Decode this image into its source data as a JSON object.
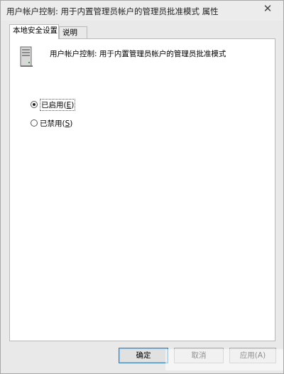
{
  "window": {
    "title": "用户帐户控制: 用于内置管理员帐户的管理员批准模式 属性",
    "close_symbol": "✕"
  },
  "tabs": [
    {
      "label": "本地安全设置",
      "active": true
    },
    {
      "label": "说明",
      "active": false
    }
  ],
  "policy": {
    "icon": "server-icon",
    "title": "用户帐户控制: 用于内置管理员帐户的管理员批准模式"
  },
  "options": [
    {
      "label_prefix": "已启用(",
      "hotkey": "E",
      "label_suffix": ")",
      "selected": true
    },
    {
      "label_prefix": "已禁用(",
      "hotkey": "S",
      "label_suffix": ")",
      "selected": false
    }
  ],
  "buttons": {
    "ok": "确定",
    "cancel": "取消",
    "apply": "应用(A)"
  }
}
